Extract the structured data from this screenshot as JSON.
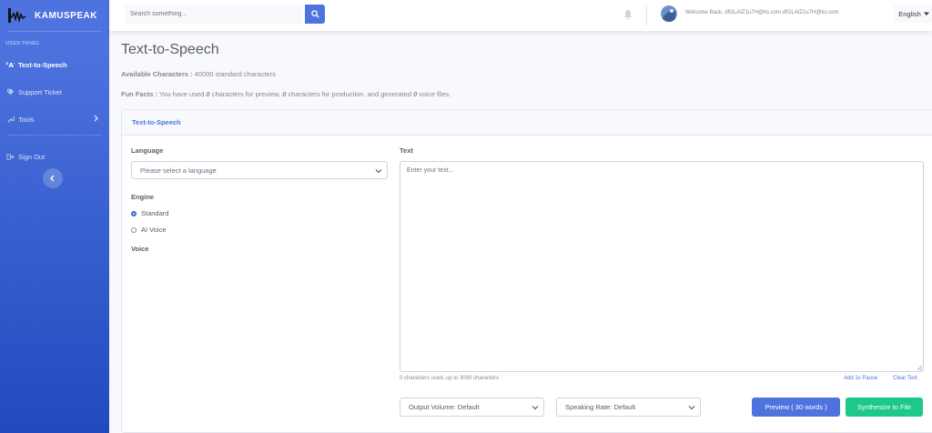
{
  "brand": {
    "name": "KAMUSPEAK"
  },
  "sidebar": {
    "heading": "USER PANEL",
    "items": [
      {
        "label": "Text-to-Speech",
        "icon": "microphone-icon",
        "active": true
      },
      {
        "label": "Support Ticket",
        "icon": "tag-icon"
      },
      {
        "label": "Tools",
        "icon": "wrench-icon"
      },
      {
        "label": "Sign Out",
        "icon": "sign-out-icon"
      }
    ]
  },
  "topbar": {
    "search_placeholder": "Search something...",
    "welcome": "Welcome Back, dfGLAIZ1u7H@ks.com dfGLAIZ1u7H@ks.com",
    "language": "English"
  },
  "main": {
    "title": "Text-to-Speech",
    "available_label": "Available Characters :",
    "available_value": "40000 standard characters",
    "fun_label": "Fun Facts :",
    "fun_text_1": "You have used",
    "fun_preview": "0",
    "fun_text_2": "characters for preview,",
    "fun_production": "0",
    "fun_text_3": "characters for production. and generated",
    "fun_files": "0",
    "fun_text_4": "voice files."
  },
  "card": {
    "header": "Text-to-Speech",
    "language_label": "Language",
    "language_select": "Please select a language",
    "engine_label": "Engine",
    "engine_options": [
      "Standard",
      "AI Voice"
    ],
    "engine_selected": "Standard",
    "voice_label": "Voice",
    "text_label": "Text",
    "text_placeholder": "Enter your text...",
    "char_count": "0 characters used, up to 3000 characters",
    "add_pause": "Add 1s Pause",
    "clear_text": "Clear Text",
    "output_volume": "Output Volume: Default",
    "speaking_rate": "Speaking Rate: Default",
    "preview_button": "Preview ( 30 words )",
    "synthesize_button": "Synthesize to File"
  },
  "colors": {
    "primary": "#4e73df",
    "success": "#1cc88a",
    "sidebar_end": "#224abe"
  }
}
